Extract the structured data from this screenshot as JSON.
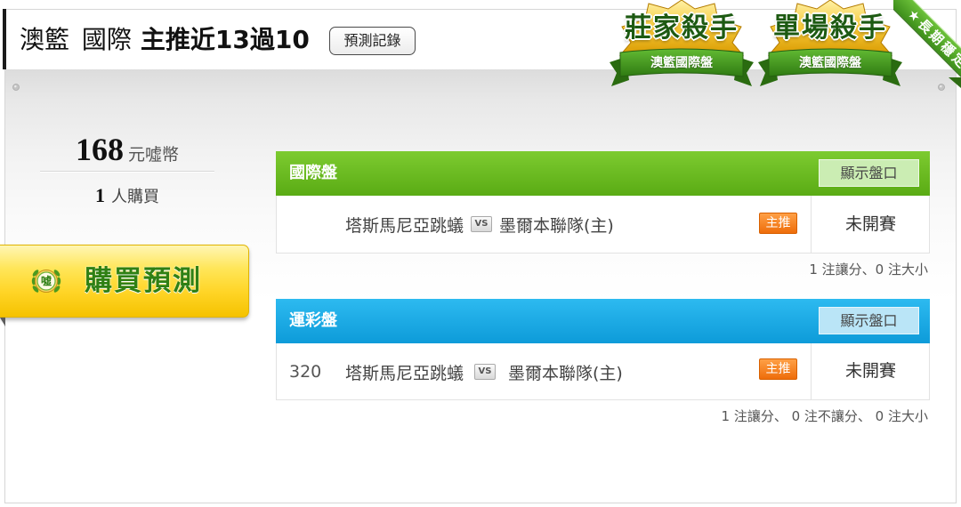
{
  "header": {
    "category": "澳籃 國際",
    "record": "主推近13過10",
    "history_button": "預測記錄"
  },
  "badges": [
    {
      "title": "莊家殺手",
      "ribbon": "澳籃國際盤"
    },
    {
      "title": "單場殺手",
      "ribbon": "澳籃國際盤"
    }
  ],
  "corner_ribbon": {
    "star": "★",
    "label": "長期穩定"
  },
  "price": {
    "amount": "168",
    "unit": "元噓幣"
  },
  "buyers": {
    "count": "1",
    "unit": "人購買"
  },
  "buy_button": {
    "icon": "coin-icon",
    "icon_char": "噓",
    "label": "購買預測"
  },
  "markets": [
    {
      "title": "國際盤",
      "toggle_label": "顯示盤口",
      "colors": {
        "header": [
          "#7dcb30",
          "#5aab14"
        ],
        "toggle": "#cbedb3"
      },
      "match": {
        "home": "塔斯馬尼亞跳蟻",
        "vs": "VS",
        "away": "墨爾本聯隊(主)",
        "pick": "主推",
        "status": "未開賽"
      },
      "summary": "1 注讓分、0 注大小"
    },
    {
      "title": "運彩盤",
      "toggle_label": "顯示盤口",
      "colors": {
        "header": [
          "#2dbaf0",
          "#0d9bd9"
        ],
        "toggle": "#bae5f7"
      },
      "match": {
        "number": "320",
        "home": "塔斯馬尼亞跳蟻",
        "vs": "VS",
        "away": "墨爾本聯隊(主)",
        "pick": "主推",
        "status": "未開賽"
      },
      "summary": "1 注讓分、 0 注不讓分、 0 注大小"
    }
  ],
  "colors": {
    "pick_badge": "#f07a1a",
    "buy_button": "#ffd527",
    "badge_text": "#1d5a12",
    "corner_ribbon": "#4aa024",
    "header_accent": "#1b1b1b"
  }
}
